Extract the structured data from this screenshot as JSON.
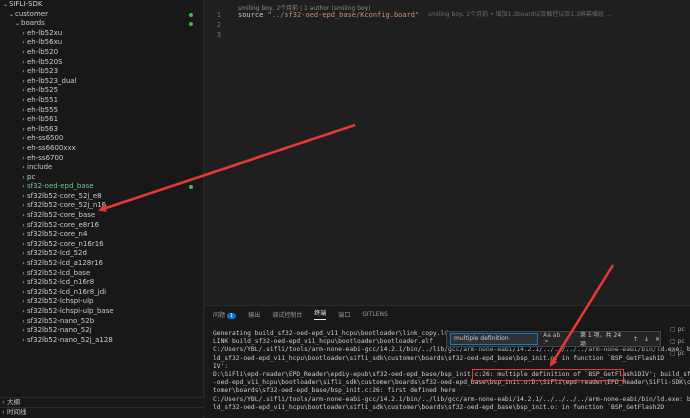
{
  "explorer": {
    "root": "SIFLI-SDK",
    "customer": "customer",
    "boards": "boards",
    "items": [
      "eh-lb52xu",
      "eh-lb56xu",
      "eh-lb520",
      "eh-lb520S",
      "eh-lb523",
      "eh-lb523_dual",
      "eh-lb525",
      "eh-lb551",
      "eh-lb555",
      "eh-lb561",
      "eh-lb563",
      "eh-ss6500",
      "eh-ss6600xxx",
      "eh-ss6700",
      "include",
      "pc",
      "sf32-oed-epd_base",
      "sf32lb52-core_52j_e8",
      "sf32lb52-core_52j_n16",
      "sf32lb52-core_base",
      "sf32lb52-core_e8r16",
      "sf32lb52-core_n4",
      "sf32lb52-core_n16r16",
      "sf32lb52-lcd_52d",
      "sf32lb52-lcd_a128r16",
      "sf32lb52-lcd_base",
      "sf32lb52-lcd_n16r8",
      "sf32lb52-lcd_n16r8_jdi",
      "sf32lb52-lchspi-ulp",
      "sf32lb52-lchspi-ulp_base",
      "sf32lb52-nano_52b",
      "sf32lb52-nano_52j",
      "sf32lb52-nano_52j_a128"
    ],
    "outline": "大纲",
    "timeline": "时间线"
  },
  "editor": {
    "codelens": "smiling boy, 2个月前 | 1 author (smiling boy)",
    "lines": [
      {
        "n": "1",
        "kw": "source ",
        "str": "\"../sf32-oed-epd_base/Kconfig.board\"",
        "blame": "smiling boy, 2个月前 • 增加1.3board以及触控以及1.3屏幕横组 …"
      },
      {
        "n": "2",
        "kw": "",
        "str": "",
        "blame": ""
      },
      {
        "n": "3",
        "kw": "",
        "str": "",
        "blame": ""
      }
    ]
  },
  "terminal": {
    "tabs": [
      "问题",
      "输出",
      "调试控制台",
      "终端",
      "端口",
      "GITLENS"
    ],
    "problem_count": "1",
    "lines": [
      "Generating build_sf32-oed-epd_v11_hcpu\\bootloader\\link_copy.lds ...",
      "LINK build_sf32-oed-epd_v11_hcpu\\bootloader\\bootloader.elf",
      "C:/Users/YBL/.sifli/tools/arm-none-eabi-gcc/14.2.1/bin/../lib/gcc/arm-none-eabi/14.2.1/../../../../arm-none-eabi/bin/ld.exe: bui",
      "ld_sf32-oed-epd_v11_hcpu\\bootloader\\sifli_sdk\\customer\\boards\\sf32-oed-epd_base\\bsp_init.o: in function `BSP_GetFlash1D",
      "IV':",
      "D:\\SiFli\\epd-reader\\EPD_Reader\\epdiy-epub\\sf32-oed-epd_base/bsp_init.c:26: multiple definition of `BSP_GetFlash1DIV'; build_sf32",
      "-oed-epd_v11_hcpu\\bootloader\\sifli_sdk\\customer\\boards\\sf32-oed-epd_base\\bsp_init.o:D:\\SiFli\\epd-reader\\EPD_Reader\\SiFli-SDK\\cus",
      "tomer\\boards\\sf32-oed-epd_base/bsp_init.c:26: first defined here",
      "C:/Users/YBL/.sifli/tools/arm-none-eabi-gcc/14.2.1/bin/../lib/gcc/arm-none-eabi/14.2.1/../../../../arm-none-eabi/bin/ld.exe: bui",
      "ld_sf32-oed-epd_v11_hcpu\\bootloader\\sifli_sdk\\customer\\boards\\sf32-oed-epd_base\\bsp_init.o: in function `BSP_GetFlash2D"
    ],
    "find": {
      "value": "multiple definition",
      "options": "Aa ab .*",
      "count": "第 1 项，共 24 项"
    },
    "right_items": [
      "pc",
      "pc",
      "pc"
    ]
  },
  "colors": {
    "accent": "#0078d4",
    "annotation": "#e53935",
    "modified": "#3fb950"
  }
}
